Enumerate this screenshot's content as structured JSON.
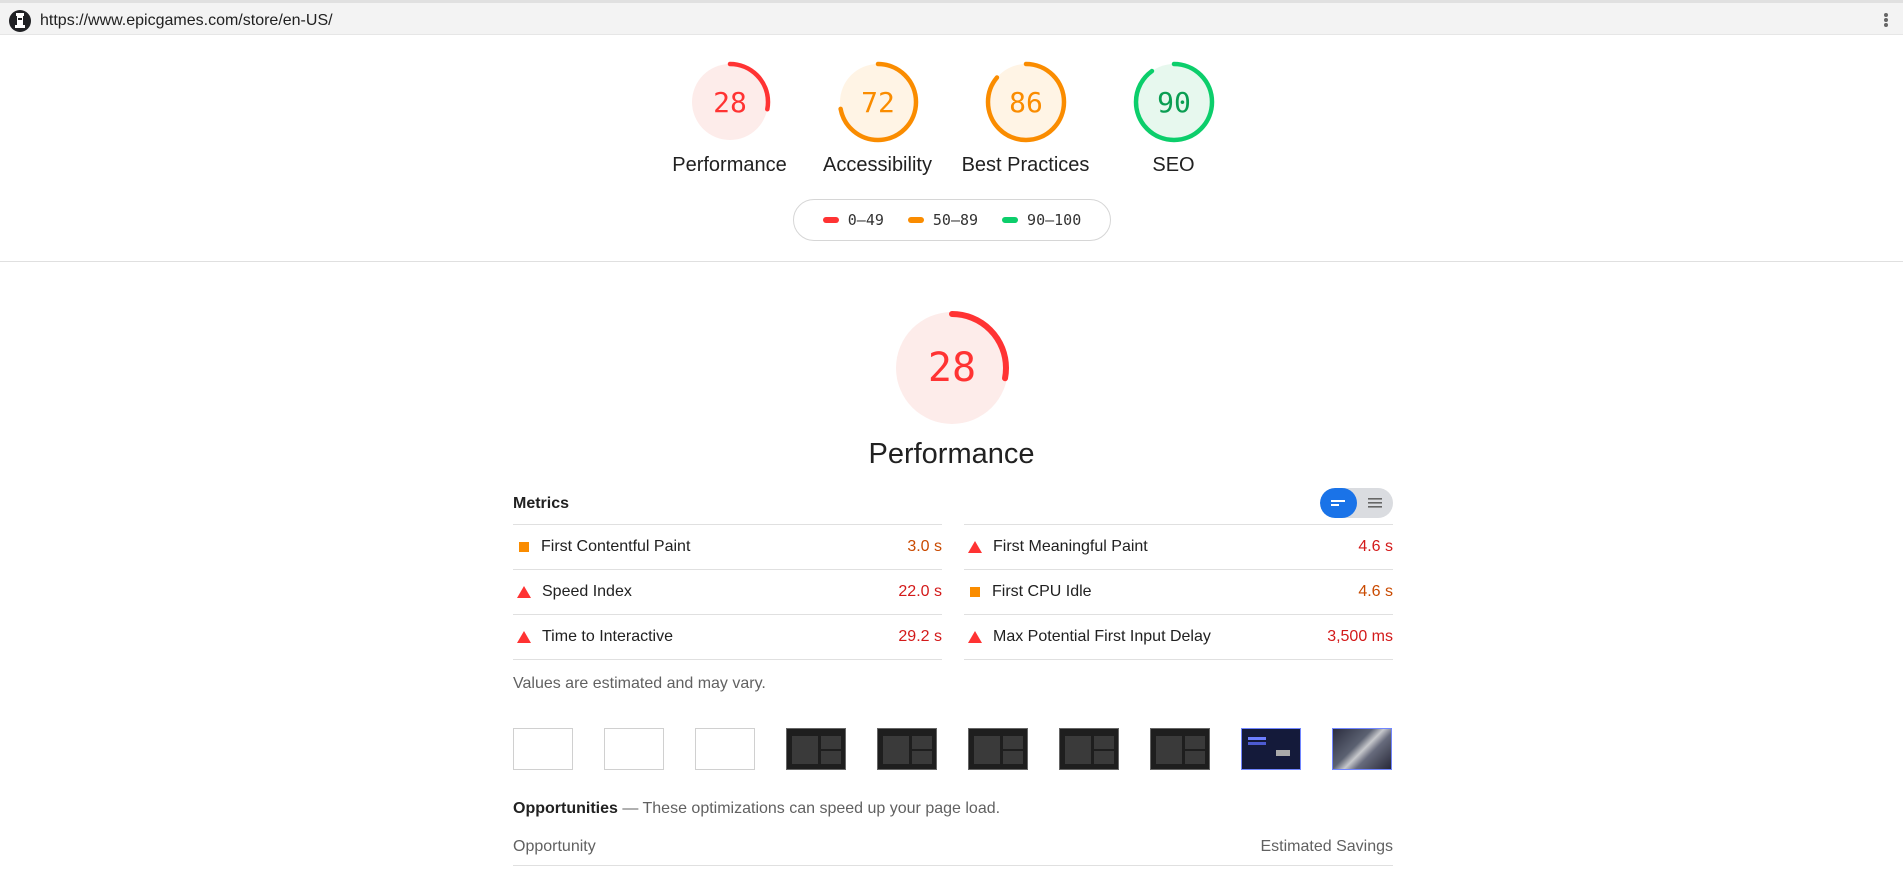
{
  "browser": {
    "url": "https://www.epicgames.com/store/en-US/",
    "logo_icon": "lighthouse-icon",
    "menu_icon": "kebab-menu-icon"
  },
  "categories": [
    {
      "label": "Performance",
      "score": "28",
      "score_value": 28,
      "rating": "fail",
      "color": "#f33",
      "text_color": "#f33",
      "fill": "#fdecea"
    },
    {
      "label": "Accessibility",
      "score": "72",
      "score_value": 72,
      "rating": "average",
      "color": "#fa8c00",
      "text_color": "#fa8c00",
      "fill": "#fff4e5"
    },
    {
      "label": "Best Practices",
      "score": "86",
      "score_value": 86,
      "rating": "average",
      "color": "#fa8c00",
      "text_color": "#fa8c00",
      "fill": "#fff4e5"
    },
    {
      "label": "SEO",
      "score": "90",
      "score_value": 90,
      "rating": "pass",
      "color": "#0cce6b",
      "text_color": "#0a9e52",
      "fill": "#e7f8ee"
    }
  ],
  "legend": [
    {
      "label": "0–49",
      "color": "#f33"
    },
    {
      "label": "50–89",
      "color": "#fa8c00"
    },
    {
      "label": "90–100",
      "color": "#0cce6b"
    }
  ],
  "performance": {
    "score": "28",
    "score_value": 28,
    "title": "Performance",
    "metrics_title": "Metrics",
    "view_toggle": {
      "active": "opportunity-view",
      "icons": [
        "compact-view-icon",
        "expanded-view-icon"
      ]
    },
    "metrics_left": [
      {
        "label": "First Contentful Paint",
        "value": "3.0 s",
        "rating": "average"
      },
      {
        "label": "Speed Index",
        "value": "22.0 s",
        "rating": "fail"
      },
      {
        "label": "Time to Interactive",
        "value": "29.2 s",
        "rating": "fail"
      }
    ],
    "metrics_right": [
      {
        "label": "First Meaningful Paint",
        "value": "4.6 s",
        "rating": "fail"
      },
      {
        "label": "First CPU Idle",
        "value": "4.6 s",
        "rating": "average"
      },
      {
        "label": "Max Potential First Input Delay",
        "value": "3,500 ms",
        "rating": "fail"
      }
    ],
    "note": "Values are estimated and may vary.",
    "filmstrip_frames": [
      "blank",
      "blank",
      "blank",
      "dark",
      "dark",
      "dark",
      "dark",
      "dark",
      "navy",
      "photo"
    ],
    "opportunities_title": "Opportunities",
    "opportunities_subtitle": "— These optimizations can speed up your page load.",
    "opportunity_col": "Opportunity",
    "savings_col": "Estimated Savings"
  }
}
